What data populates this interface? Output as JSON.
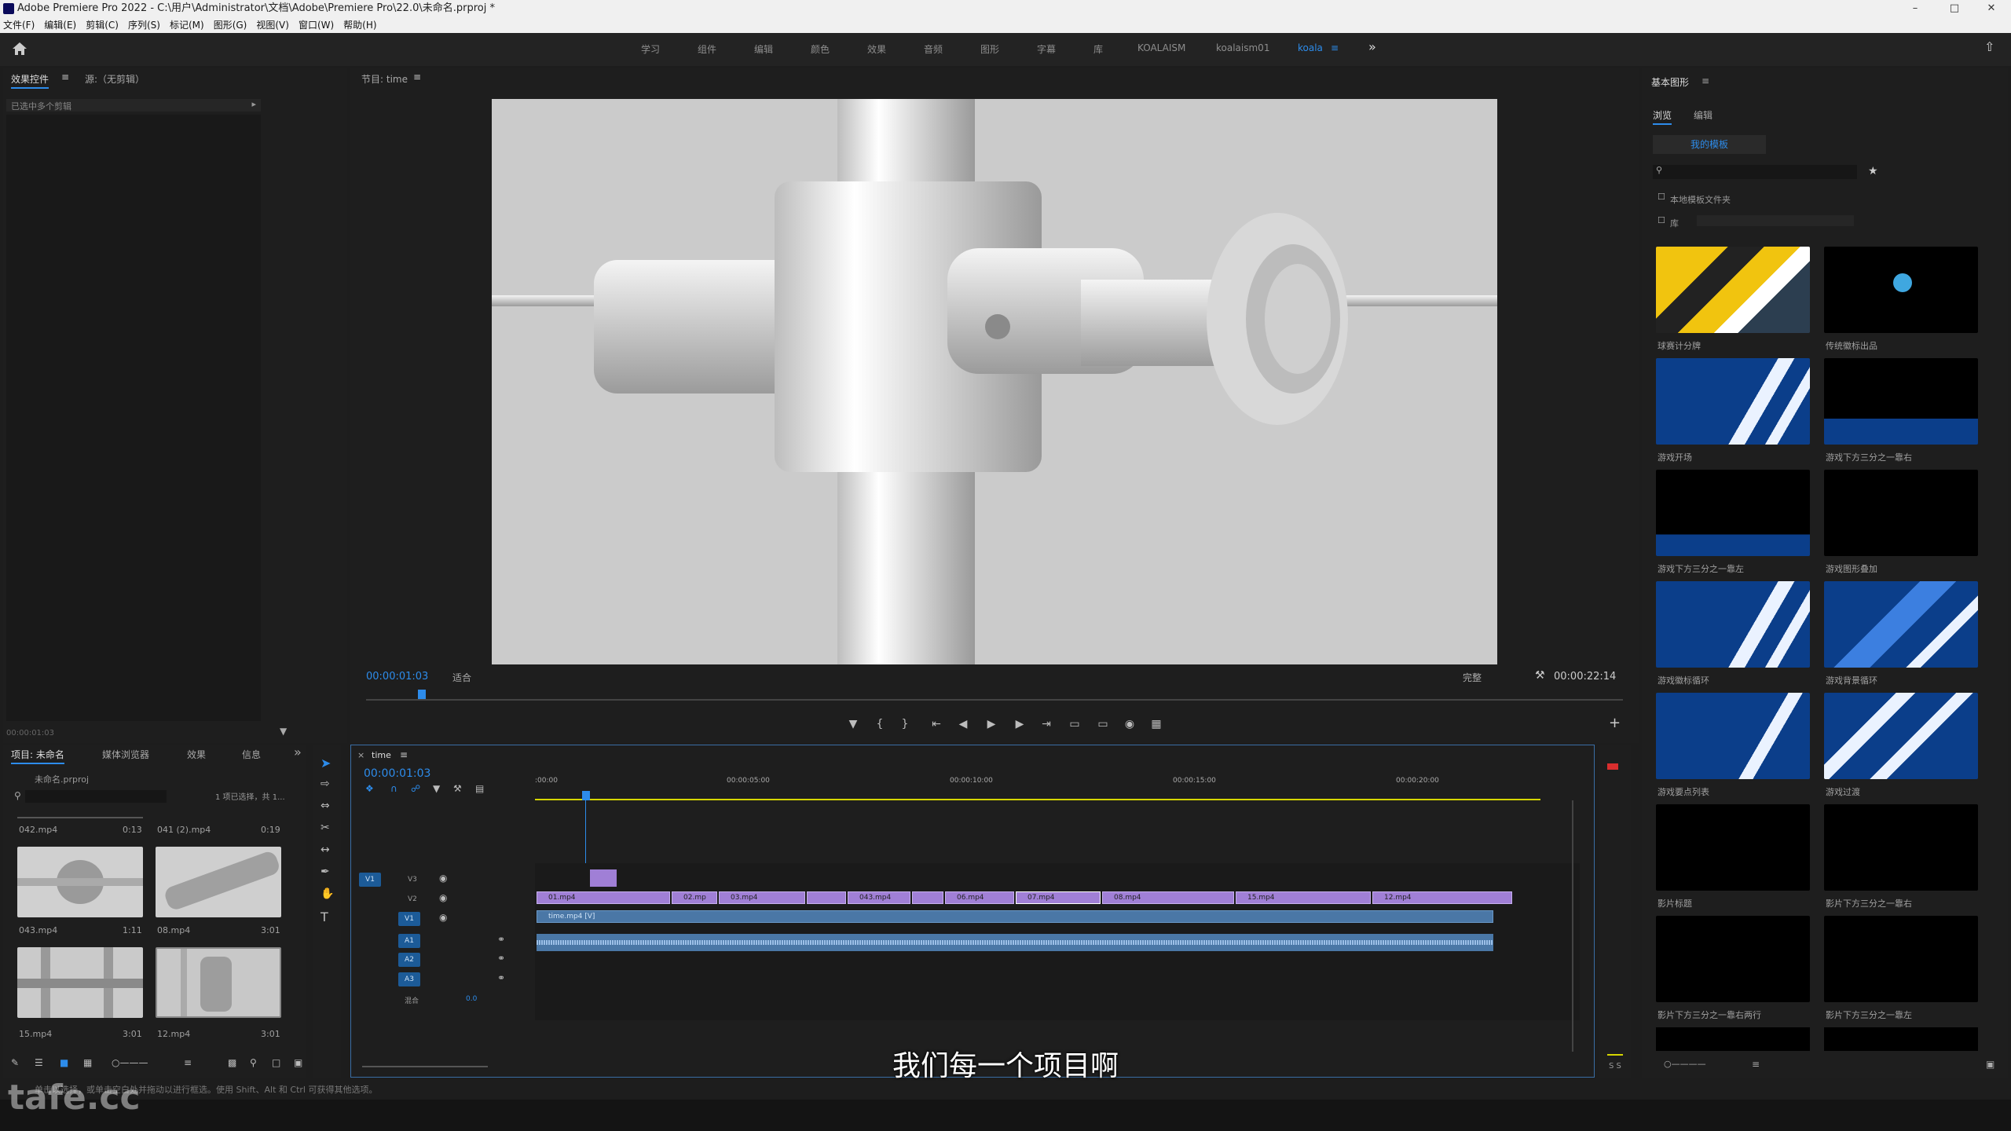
{
  "window": {
    "title": "Adobe Premiere Pro 2022 - C:\\用户\\Administrator\\文档\\Adobe\\Premiere Pro\\22.0\\未命名.prproj *"
  },
  "menu": [
    "文件(F)",
    "编辑(E)",
    "剪辑(C)",
    "序列(S)",
    "标记(M)",
    "图形(G)",
    "视图(V)",
    "窗口(W)",
    "帮助(H)"
  ],
  "workspaces": [
    "学习",
    "组件",
    "编辑",
    "颜色",
    "效果",
    "音频",
    "图形",
    "字幕",
    "库",
    "KOALAISM",
    "koalaism01",
    "koala"
  ],
  "workspace_active": "koala",
  "effects_panel": {
    "tab1": "效果控件",
    "tab2": "源:（无剪辑）",
    "no_clip": "已选中多个剪辑",
    "timecode": "00:00:01:03"
  },
  "program": {
    "title": "节目: time",
    "timecode": "00:00:01:03",
    "fit": "适合",
    "quality": "完整",
    "duration": "00:00:22:14"
  },
  "project": {
    "tabs": [
      "项目: 未命名",
      "媒体浏览器",
      "效果",
      "信息"
    ],
    "file": "未命名.prproj",
    "selection": "1 项已选择，共 1...",
    "items": [
      {
        "name": "042.mp4",
        "dur": "0:13"
      },
      {
        "name": "041 (2).mp4",
        "dur": "0:19"
      },
      {
        "name": "043.mp4",
        "dur": "1:11"
      },
      {
        "name": "08.mp4",
        "dur": "3:01"
      },
      {
        "name": "15.mp4",
        "dur": "3:01"
      },
      {
        "name": "12.mp4",
        "dur": "3:01"
      }
    ]
  },
  "timeline": {
    "title": "time",
    "timecode": "00:00:01:03",
    "ruler": [
      ":00:00",
      "00:00:05:00",
      "00:00:10:00",
      "00:00:15:00",
      "00:00:20:00"
    ],
    "tracks": [
      "V3",
      "V2",
      "V1",
      "A1",
      "A2",
      "A3"
    ],
    "mix": "混合",
    "mix_val": "0.0",
    "clips_v2": [
      "01.mp4",
      "02.mp",
      "03.mp4",
      "043.mp4",
      "06.mp4",
      "07.mp4",
      "08.mp4",
      "15.mp4",
      "12.mp4"
    ],
    "clip_v1": "time.mp4 [V]"
  },
  "essential": {
    "title": "基本图形",
    "tabs": [
      "浏览",
      "编辑"
    ],
    "templates_btn": "我的模板",
    "local": "本地模板文件夹",
    "lib": "库",
    "items": [
      "球赛计分牌",
      "传统徽标出品",
      "游戏开场",
      "游戏下方三分之一靠右",
      "游戏下方三分之一靠左",
      "游戏图形叠加",
      "游戏徽标循环",
      "游戏背景循环",
      "游戏要点列表",
      "游戏过渡",
      "影片标题",
      "影片下方三分之一靠右",
      "影片下方三分之一靠右两行",
      "影片下方三分之一靠左"
    ]
  },
  "subtitle": "我们每一个项目啊",
  "status": "单击以选择，或单击空白处并拖动以进行框选。使用 Shift、Alt 和 Ctrl 可获得其他选项。",
  "watermark": "tafe.cc",
  "colors": {
    "accent": "#2d8ceb",
    "clip": "#a07fd6",
    "audio": "#4a77a6"
  }
}
